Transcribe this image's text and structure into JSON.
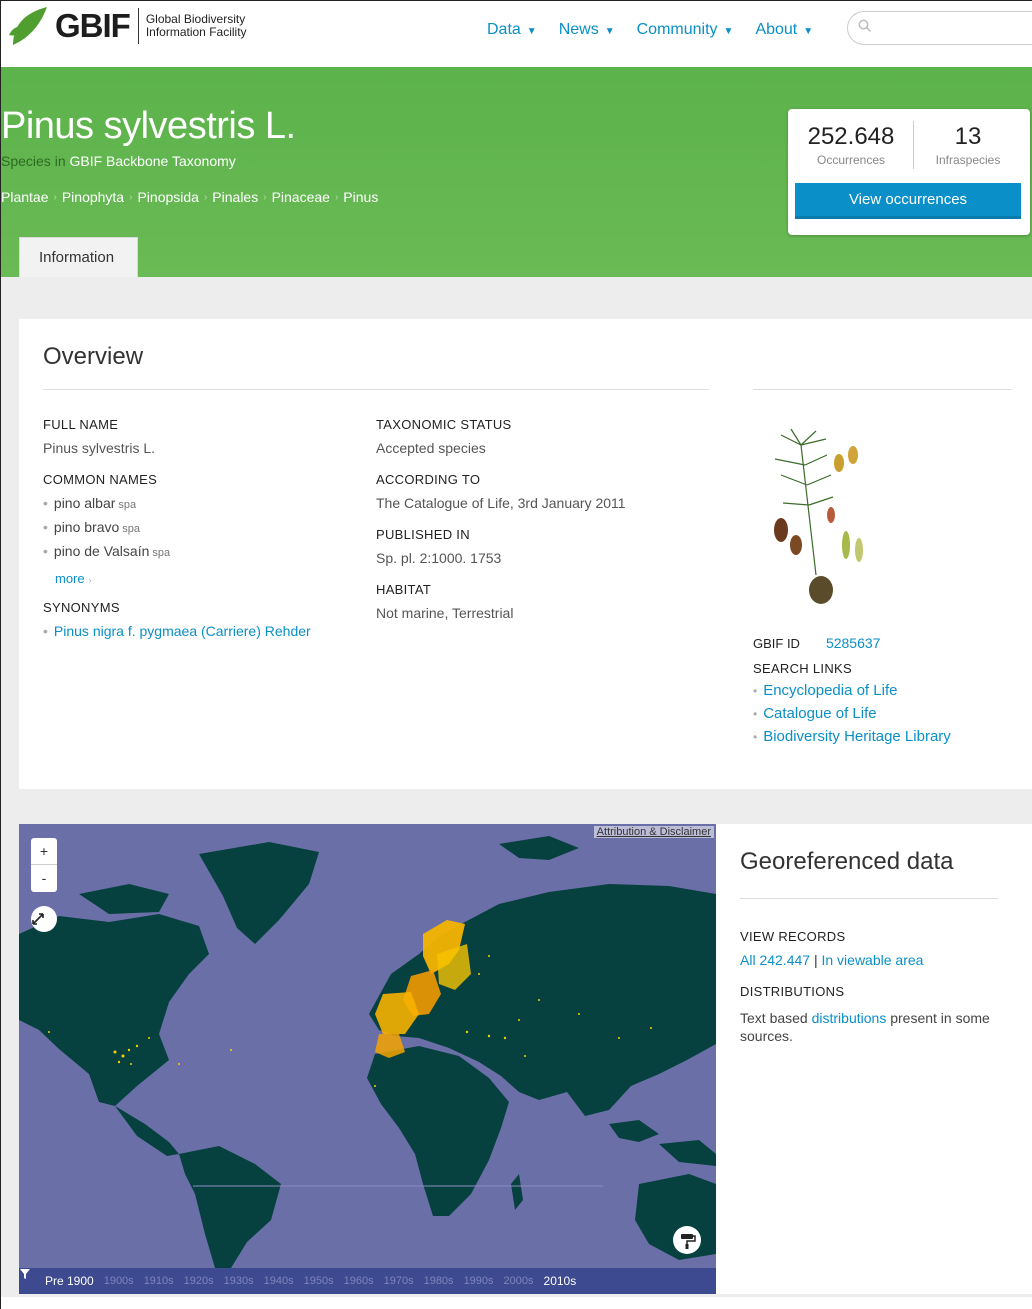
{
  "brand": {
    "name": "GBIF",
    "line1": "Global Biodiversity",
    "line2": "Information Facility"
  },
  "nav": {
    "items": [
      "Data",
      "News",
      "Community",
      "About"
    ]
  },
  "search": {
    "placeholder": ""
  },
  "species": {
    "title": "Pinus sylvestris L.",
    "rank": "Species",
    "in_word": "in",
    "checklist": "GBIF Backbone Taxonomy",
    "breadcrumb": [
      "Plantae",
      "Pinophyta",
      "Pinopsida",
      "Pinales",
      "Pinaceae",
      "Pinus"
    ],
    "tab": "Information"
  },
  "stats": {
    "occurrences": "252.648",
    "occurrences_label": "Occurrences",
    "infraspecies": "13",
    "infraspecies_label": "Infraspecies",
    "button": "View occurrences"
  },
  "overview": {
    "title": "Overview",
    "full_name_label": "FULL NAME",
    "full_name": "Pinus sylvestris L.",
    "common_names_label": "COMMON NAMES",
    "common_names": [
      {
        "name": "pino albar",
        "lang": "spa"
      },
      {
        "name": "pino bravo",
        "lang": "spa"
      },
      {
        "name": "pino de Valsaín",
        "lang": "spa"
      }
    ],
    "more": "more",
    "synonyms_label": "SYNONYMS",
    "synonyms": [
      "Pinus nigra f. pygmaea (Carriere) Rehder"
    ],
    "taxonomic_status_label": "TAXONOMIC STATUS",
    "taxonomic_status": "Accepted species",
    "according_to_label": "ACCORDING TO",
    "according_to": "The Catalogue of Life, 3rd January 2011",
    "published_in_label": "PUBLISHED IN",
    "published_in": "Sp. pl. 2:1000. 1753",
    "habitat_label": "HABITAT",
    "habitat": "Not marine, Terrestrial",
    "gbif_id_label": "GBIF ID",
    "gbif_id": "5285637",
    "search_links_label": "SEARCH LINKS",
    "search_links": [
      "Encyclopedia of Life",
      "Catalogue of Life",
      "Biodiversity Heritage Library"
    ]
  },
  "map": {
    "attribution": "Attribution & Disclaimer",
    "zoom_in": "+",
    "zoom_out": "-",
    "timeline": [
      "Pre 1900",
      "1900s",
      "1910s",
      "1920s",
      "1930s",
      "1940s",
      "1950s",
      "1960s",
      "1970s",
      "1980s",
      "1990s",
      "2000s",
      "2010s"
    ],
    "timeline_active": [
      "Pre 1900",
      "2010s"
    ],
    "colors": {
      "ocean": "#6b6fa8",
      "land": "#06403f",
      "points": "#f5b400"
    }
  },
  "georef": {
    "title": "Georeferenced data",
    "view_records_label": "VIEW RECORDS",
    "all_records": "All 242.447",
    "separator": "|",
    "in_view": "In viewable area",
    "distributions_label": "DISTRIBUTIONS",
    "dist_prefix": "Text based",
    "dist_link": "distributions",
    "dist_suffix": "present in some sources."
  },
  "icons": [
    "leaf-logo-icon",
    "search-icon",
    "expand-icon",
    "paint-roller-icon",
    "filter-icon"
  ],
  "colors": {
    "accent": "#0a8fc8",
    "header_green": "#5cb24b"
  }
}
